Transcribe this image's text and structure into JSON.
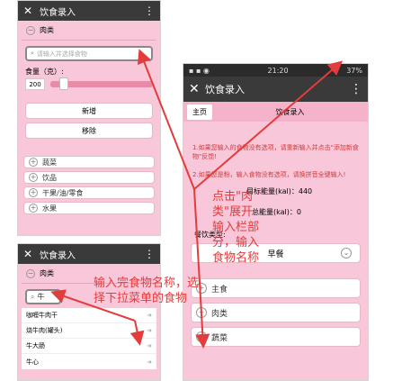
{
  "p1": {
    "title": "饮食录入",
    "category": "肉类",
    "search_placeholder": "请输入并选择食物",
    "amount_label": "食量（克）:",
    "amount_value": "200",
    "add_btn": "新增",
    "remove_btn": "移除",
    "cats": [
      "蔬菜",
      "饮品",
      "干果/油/零食",
      "水果"
    ]
  },
  "p2": {
    "title": "饮食录入",
    "category": "肉类",
    "search_value": "牛",
    "results": [
      "咖喱牛肉干",
      "烧牛肉(罐头)",
      "牛大肠",
      "牛心"
    ]
  },
  "p3": {
    "status_time": "21:20",
    "status_batt": "37%",
    "title": "饮食录入",
    "tab_home": "主页",
    "tab_entry": "饮食录入",
    "note1": "1.如果您输入的食物没有选项，请重新输入并点击\"添加新食物\"反馈!",
    "note2": "2.如果您是粉，输入食物没有选项，请换拼音全键输入!",
    "target_energy": "目标能量(kal)：440",
    "total_energy": "总能量(kal)：0",
    "meal_type_label": "餐饮类型:",
    "meal_type_value": "早餐",
    "cats": [
      "主食",
      "肉类",
      "蔬菜"
    ]
  },
  "annotations": {
    "a1": "点击\"肉类\"展开输入栏部分，输入食物名称",
    "a2": "输入完食物名称，选择下拉菜单的食物"
  },
  "colors": {
    "annot": "#e23c3c",
    "bg": "#f8c7d9",
    "titlebar": "#3a3a3a"
  }
}
